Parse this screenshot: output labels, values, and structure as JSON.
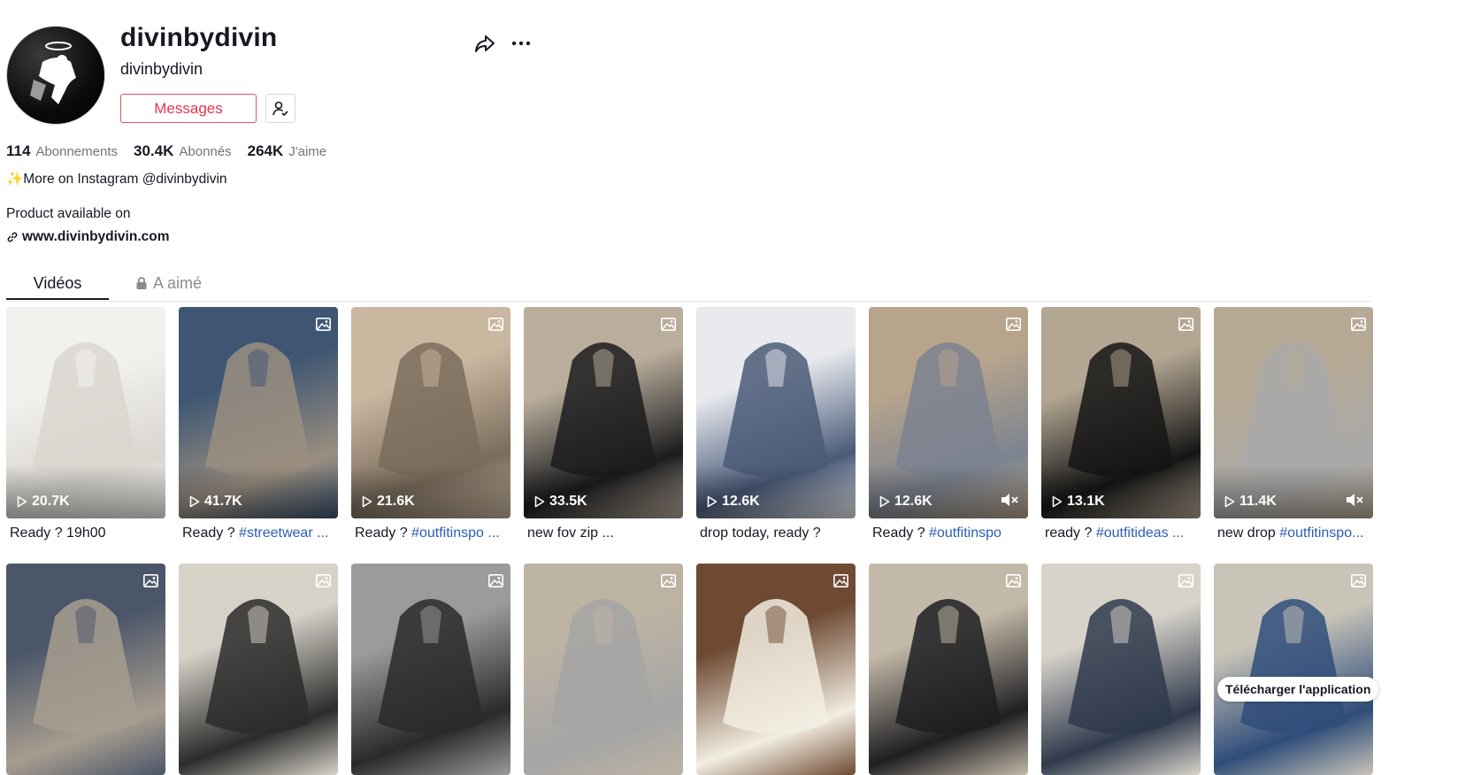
{
  "profile": {
    "display_name": "divinbydivin",
    "username": "divinbydivin",
    "messages_label": "Messages",
    "stats": [
      {
        "value": "114",
        "label": "Abonnements"
      },
      {
        "value": "30.4K",
        "label": "Abonnés"
      },
      {
        "value": "264K",
        "label": "J'aime"
      }
    ],
    "bio_line1": "✨More on Instagram @divinbydivin",
    "bio_line2": "Product available on",
    "link": "www.divinbydivin.com"
  },
  "icons": {
    "share": "share-icon",
    "more": "more-icon",
    "follow_status": "user-check-icon",
    "link": "link-icon",
    "lock": "lock-icon",
    "image": "image-icon",
    "play": "play-icon",
    "mute": "mute-icon"
  },
  "tabs": [
    {
      "label": "Vidéos",
      "active": true
    },
    {
      "label": "A aimé",
      "active": false,
      "locked": true
    }
  ],
  "videos_row1": [
    {
      "views": "20.7K",
      "caption": "Ready ? 19h00",
      "tag": ""
    },
    {
      "views": "41.7K",
      "caption": "Ready ? ",
      "tag": "#streetwear ..."
    },
    {
      "views": "21.6K",
      "caption": "Ready ? ",
      "tag": "#outfitinspo ..."
    },
    {
      "views": "33.5K",
      "caption": "new fov zip ...",
      "tag": ""
    },
    {
      "views": "12.6K",
      "caption": "drop today, ready ?",
      "tag": ""
    },
    {
      "views": "12.6K",
      "caption": "Ready ? ",
      "tag": "#outfitinspo"
    },
    {
      "views": "13.1K",
      "caption": "ready ? ",
      "tag": "#outfitideas ..."
    },
    {
      "views": "11.4K",
      "caption": "new drop ",
      "tag": "#outfitinspo..."
    }
  ],
  "download_label": "Télécharger l'application",
  "colors": {
    "accent": "#fe2c55",
    "text": "#161823",
    "muted": "#73737a",
    "hashtag": "#2b5db9"
  }
}
